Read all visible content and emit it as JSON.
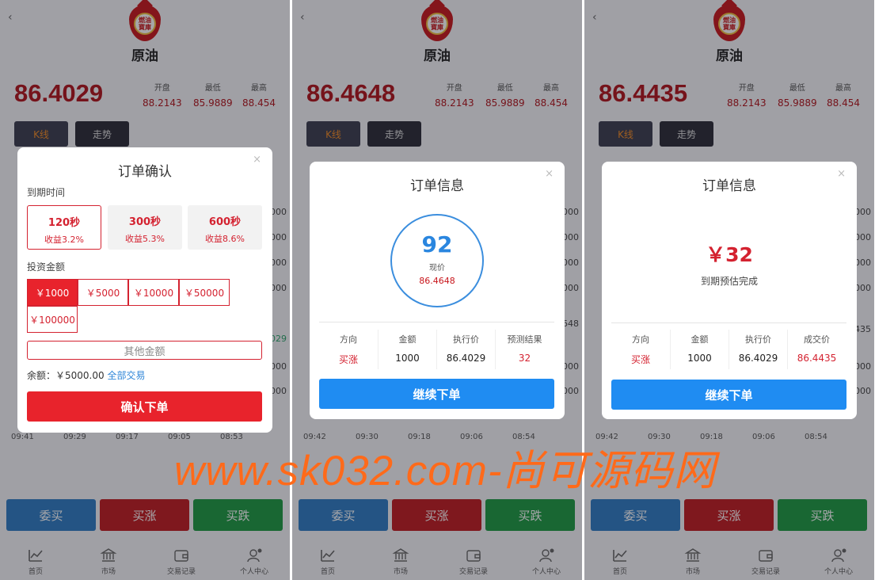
{
  "app": {
    "title": "原油",
    "logo_text": [
      "燃油",
      "寶庫"
    ],
    "back_label": "‹",
    "stats_labels": [
      "开盘",
      "最低",
      "最高"
    ],
    "stats_values": [
      "88.2143",
      "85.9889",
      "88.454"
    ],
    "tabs": [
      "K线",
      "走势"
    ],
    "price_labels": [
      "000",
      "000",
      "000",
      "000",
      "000",
      "000",
      "000",
      "000"
    ],
    "buttons": [
      "委买",
      "买涨",
      "买跌"
    ],
    "nav": [
      "首页",
      "市场",
      "交易记录",
      "个人中心"
    ]
  },
  "panels": [
    {
      "price": "86.4029",
      "line_tag": "029",
      "times": [
        "09:41",
        "09:29",
        "09:17",
        "09:05",
        "08:53"
      ]
    },
    {
      "price": "86.4648",
      "line_tag": "648",
      "times": [
        "09:42",
        "09:30",
        "09:18",
        "09:06",
        "08:54"
      ]
    },
    {
      "price": "86.4435",
      "line_tag": "435",
      "times": [
        "09:42",
        "09:30",
        "09:18",
        "09:06",
        "08:54"
      ]
    }
  ],
  "order_confirm": {
    "title": "订单确认",
    "close": "×",
    "expiry_label": "到期时间",
    "options": [
      {
        "time": "120秒",
        "rate": "收益3.2%"
      },
      {
        "time": "300秒",
        "rate": "收益5.3%"
      },
      {
        "time": "600秒",
        "rate": "收益8.6%"
      }
    ],
    "amount_label": "投资金额",
    "amounts": [
      "￥1000",
      "￥5000",
      "￥10000",
      "￥50000",
      "￥100000"
    ],
    "other_amount": "其他金额",
    "balance_label": "余额：￥5000.00",
    "all_trade": "全部交易",
    "confirm": "确认下单"
  },
  "order_info_1": {
    "title": "订单信息",
    "close": "×",
    "countdown": "92",
    "current_label": "现价",
    "current_price": "86.4648",
    "headers": [
      "方向",
      "金额",
      "执行价",
      "预测结果"
    ],
    "values": [
      "买涨",
      "1000",
      "86.4029",
      "32"
    ],
    "continue": "继续下单"
  },
  "order_info_2": {
    "title": "订单信息",
    "close": "×",
    "amount": "￥32",
    "sub": "到期预估完成",
    "headers": [
      "方向",
      "金额",
      "执行价",
      "成交价"
    ],
    "values": [
      "买涨",
      "1000",
      "86.4029",
      "86.4435"
    ],
    "continue": "继续下单"
  },
  "watermark": "www.sk032.com-尚可源码网",
  "colors": {
    "red": "#c8151b",
    "blue": "#1f8cf2",
    "green": "#1c9a41"
  }
}
